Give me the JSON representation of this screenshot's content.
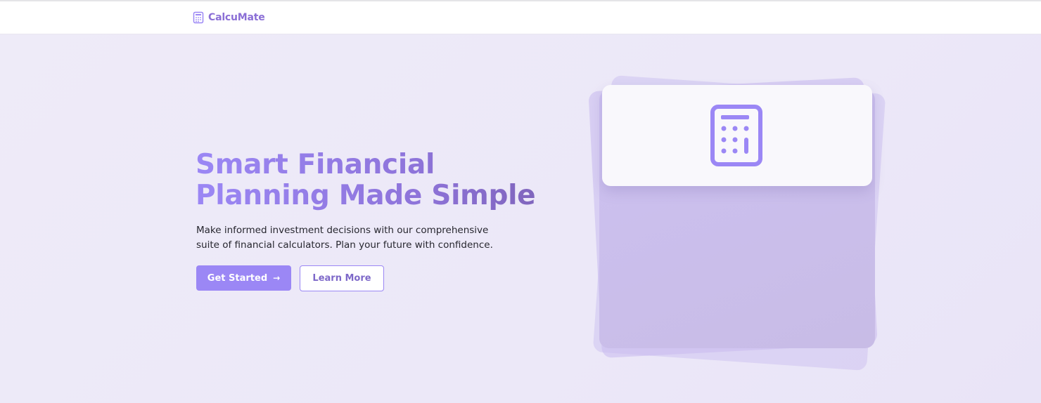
{
  "brand": {
    "name": "CalcuMate",
    "icon": "calculator-icon"
  },
  "hero": {
    "title_line1": "Smart Financial",
    "title_line2": "Planning Made Simple",
    "subtitle": "Make informed investment decisions with our comprehensive suite of financial calculators. Plan your future with confidence.",
    "primary_button": {
      "label": "Get Started",
      "icon": "arrow-right-icon"
    },
    "secondary_button": {
      "label": "Learn More"
    },
    "illustration_icon": "calculator-icon"
  },
  "colors": {
    "accent": "#9b87f5",
    "accent_dark": "#7e69c9",
    "background": "#efecf9"
  }
}
